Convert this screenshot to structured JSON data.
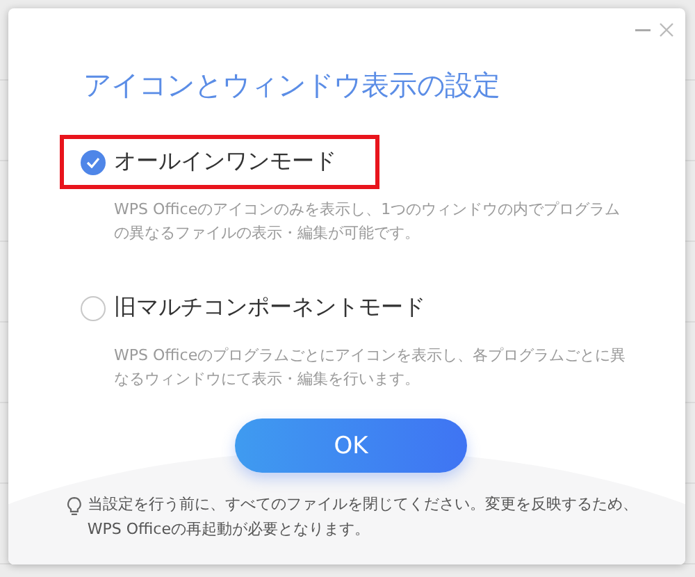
{
  "dialog": {
    "title": "アイコンとウィンドウ表示の設定",
    "options": [
      {
        "label": "オールインワンモード",
        "selected": true,
        "highlighted": true,
        "description": "WPS Officeのアイコンのみを表示し、1つのウィンドウの内でプログラムの異なるファイルの表示・編集が可能です。"
      },
      {
        "label": "旧マルチコンポーネントモード",
        "selected": false,
        "highlighted": false,
        "description": "WPS Officeのプログラムごとにアイコンを表示し、各プログラムごとに異なるウィンドウにて表示・編集を行います。"
      }
    ],
    "ok_button": "OK",
    "note": "当設定を行う前に、すべてのファイルを閉じてください。変更を反映するため、WPS Officeの再起動が必要となります。"
  }
}
